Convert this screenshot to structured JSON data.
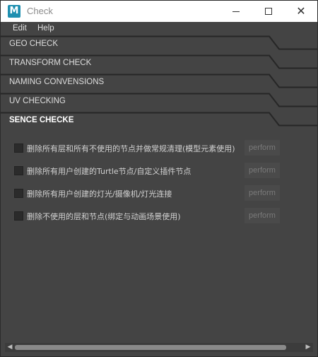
{
  "window": {
    "title": "Check",
    "app_icon_letter": "M"
  },
  "menu": {
    "items": [
      "Edit",
      "Help"
    ]
  },
  "sections": [
    {
      "label": "GEO CHECK",
      "active": false
    },
    {
      "label": "TRANSFORM CHECK",
      "active": false
    },
    {
      "label": "NAMING CONVENSIONS",
      "active": false
    },
    {
      "label": "UV CHECKING",
      "active": false
    },
    {
      "label": "SENCE CHECKE",
      "active": true
    }
  ],
  "checks": [
    {
      "label": "删除所有层和所有不使用的节点并做常规清理(模型元素使用)",
      "checked": false,
      "button": "perform"
    },
    {
      "label": "删除所有用户创建的Turtle节点/自定义插件节点",
      "checked": false,
      "button": "perform"
    },
    {
      "label": "删除所有用户创建的灯光/摄像机/灯光连接",
      "checked": false,
      "button": "perform"
    },
    {
      "label": "删除不使用的层和节点(绑定与动画场景使用)",
      "checked": false,
      "button": "perform"
    }
  ],
  "scrollbar": {
    "left_arrow": "◀",
    "right_arrow": "▶"
  },
  "colors": {
    "accent": "#1e8fb0",
    "background": "#444444",
    "titlebar": "#ffffff"
  }
}
